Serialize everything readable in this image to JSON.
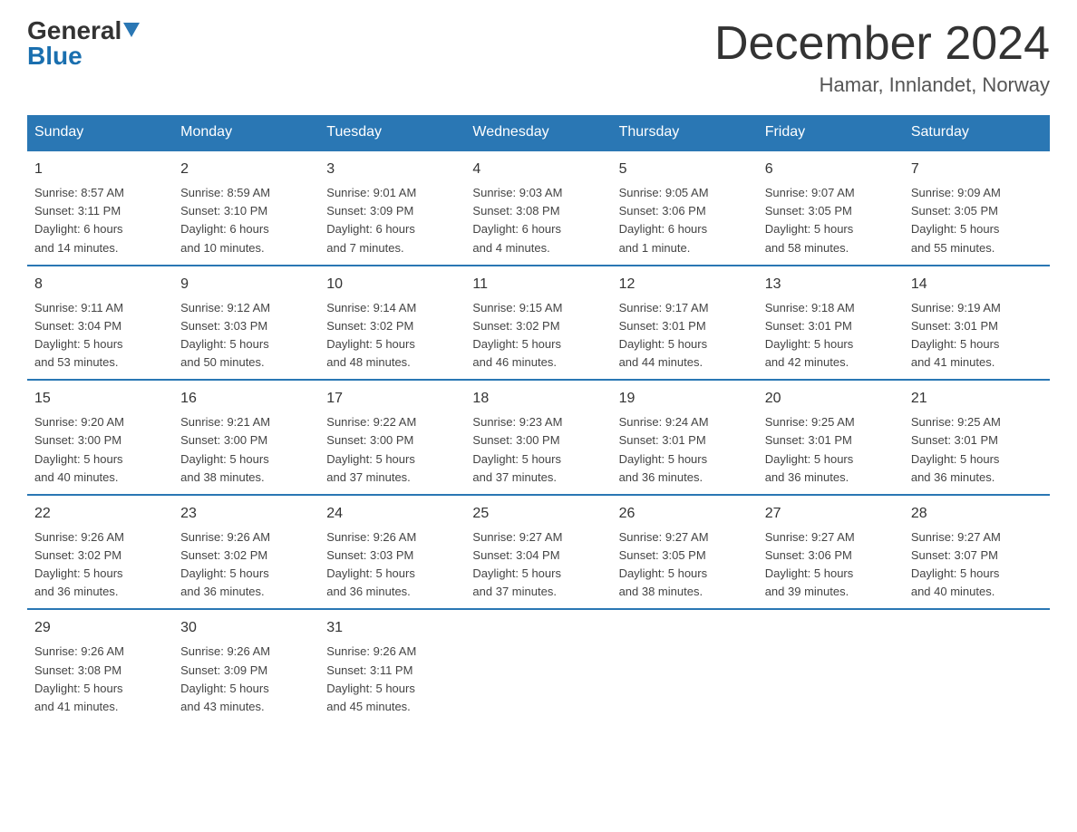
{
  "logo": {
    "text_general": "General",
    "text_blue": "Blue",
    "triangle_desc": "blue triangle arrow"
  },
  "header": {
    "title": "December 2024",
    "subtitle": "Hamar, Innlandet, Norway"
  },
  "weekdays": [
    "Sunday",
    "Monday",
    "Tuesday",
    "Wednesday",
    "Thursday",
    "Friday",
    "Saturday"
  ],
  "weeks": [
    [
      {
        "day": "1",
        "info": "Sunrise: 8:57 AM\nSunset: 3:11 PM\nDaylight: 6 hours\nand 14 minutes."
      },
      {
        "day": "2",
        "info": "Sunrise: 8:59 AM\nSunset: 3:10 PM\nDaylight: 6 hours\nand 10 minutes."
      },
      {
        "day": "3",
        "info": "Sunrise: 9:01 AM\nSunset: 3:09 PM\nDaylight: 6 hours\nand 7 minutes."
      },
      {
        "day": "4",
        "info": "Sunrise: 9:03 AM\nSunset: 3:08 PM\nDaylight: 6 hours\nand 4 minutes."
      },
      {
        "day": "5",
        "info": "Sunrise: 9:05 AM\nSunset: 3:06 PM\nDaylight: 6 hours\nand 1 minute."
      },
      {
        "day": "6",
        "info": "Sunrise: 9:07 AM\nSunset: 3:05 PM\nDaylight: 5 hours\nand 58 minutes."
      },
      {
        "day": "7",
        "info": "Sunrise: 9:09 AM\nSunset: 3:05 PM\nDaylight: 5 hours\nand 55 minutes."
      }
    ],
    [
      {
        "day": "8",
        "info": "Sunrise: 9:11 AM\nSunset: 3:04 PM\nDaylight: 5 hours\nand 53 minutes."
      },
      {
        "day": "9",
        "info": "Sunrise: 9:12 AM\nSunset: 3:03 PM\nDaylight: 5 hours\nand 50 minutes."
      },
      {
        "day": "10",
        "info": "Sunrise: 9:14 AM\nSunset: 3:02 PM\nDaylight: 5 hours\nand 48 minutes."
      },
      {
        "day": "11",
        "info": "Sunrise: 9:15 AM\nSunset: 3:02 PM\nDaylight: 5 hours\nand 46 minutes."
      },
      {
        "day": "12",
        "info": "Sunrise: 9:17 AM\nSunset: 3:01 PM\nDaylight: 5 hours\nand 44 minutes."
      },
      {
        "day": "13",
        "info": "Sunrise: 9:18 AM\nSunset: 3:01 PM\nDaylight: 5 hours\nand 42 minutes."
      },
      {
        "day": "14",
        "info": "Sunrise: 9:19 AM\nSunset: 3:01 PM\nDaylight: 5 hours\nand 41 minutes."
      }
    ],
    [
      {
        "day": "15",
        "info": "Sunrise: 9:20 AM\nSunset: 3:00 PM\nDaylight: 5 hours\nand 40 minutes."
      },
      {
        "day": "16",
        "info": "Sunrise: 9:21 AM\nSunset: 3:00 PM\nDaylight: 5 hours\nand 38 minutes."
      },
      {
        "day": "17",
        "info": "Sunrise: 9:22 AM\nSunset: 3:00 PM\nDaylight: 5 hours\nand 37 minutes."
      },
      {
        "day": "18",
        "info": "Sunrise: 9:23 AM\nSunset: 3:00 PM\nDaylight: 5 hours\nand 37 minutes."
      },
      {
        "day": "19",
        "info": "Sunrise: 9:24 AM\nSunset: 3:01 PM\nDaylight: 5 hours\nand 36 minutes."
      },
      {
        "day": "20",
        "info": "Sunrise: 9:25 AM\nSunset: 3:01 PM\nDaylight: 5 hours\nand 36 minutes."
      },
      {
        "day": "21",
        "info": "Sunrise: 9:25 AM\nSunset: 3:01 PM\nDaylight: 5 hours\nand 36 minutes."
      }
    ],
    [
      {
        "day": "22",
        "info": "Sunrise: 9:26 AM\nSunset: 3:02 PM\nDaylight: 5 hours\nand 36 minutes."
      },
      {
        "day": "23",
        "info": "Sunrise: 9:26 AM\nSunset: 3:02 PM\nDaylight: 5 hours\nand 36 minutes."
      },
      {
        "day": "24",
        "info": "Sunrise: 9:26 AM\nSunset: 3:03 PM\nDaylight: 5 hours\nand 36 minutes."
      },
      {
        "day": "25",
        "info": "Sunrise: 9:27 AM\nSunset: 3:04 PM\nDaylight: 5 hours\nand 37 minutes."
      },
      {
        "day": "26",
        "info": "Sunrise: 9:27 AM\nSunset: 3:05 PM\nDaylight: 5 hours\nand 38 minutes."
      },
      {
        "day": "27",
        "info": "Sunrise: 9:27 AM\nSunset: 3:06 PM\nDaylight: 5 hours\nand 39 minutes."
      },
      {
        "day": "28",
        "info": "Sunrise: 9:27 AM\nSunset: 3:07 PM\nDaylight: 5 hours\nand 40 minutes."
      }
    ],
    [
      {
        "day": "29",
        "info": "Sunrise: 9:26 AM\nSunset: 3:08 PM\nDaylight: 5 hours\nand 41 minutes."
      },
      {
        "day": "30",
        "info": "Sunrise: 9:26 AM\nSunset: 3:09 PM\nDaylight: 5 hours\nand 43 minutes."
      },
      {
        "day": "31",
        "info": "Sunrise: 9:26 AM\nSunset: 3:11 PM\nDaylight: 5 hours\nand 45 minutes."
      },
      null,
      null,
      null,
      null
    ]
  ]
}
